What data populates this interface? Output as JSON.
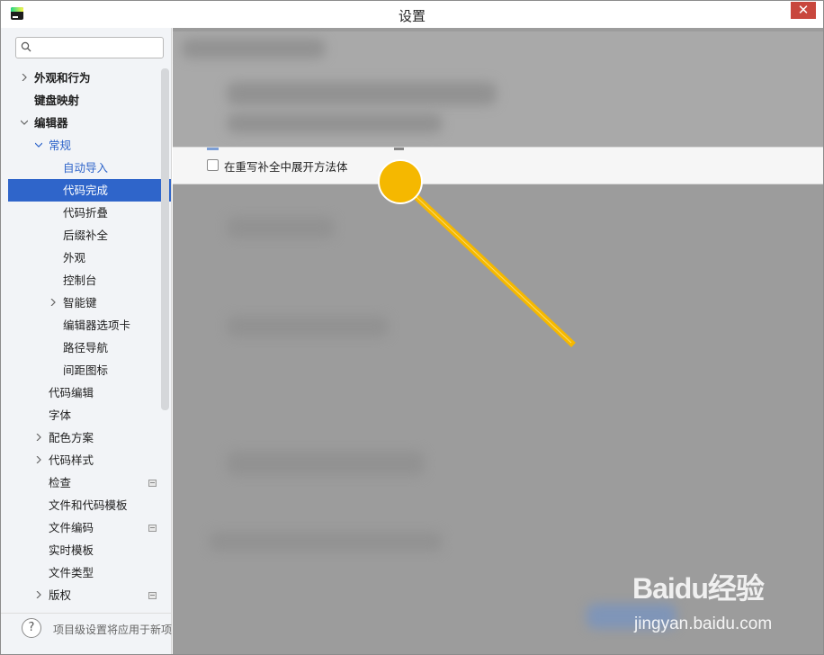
{
  "window": {
    "title": "设置",
    "close_symbol": "✕"
  },
  "search": {
    "placeholder": "",
    "icon": "search-icon"
  },
  "tree": {
    "items": [
      {
        "label": "外观和行为",
        "expandable": true,
        "expanded": false
      },
      {
        "label": "键盘映射",
        "expandable": false
      },
      {
        "label": "编辑器",
        "expandable": true,
        "expanded": true
      },
      {
        "label": "常规",
        "expandable": true,
        "expanded": true
      },
      {
        "label": "自动导入"
      },
      {
        "label": "代码完成",
        "selected": true
      },
      {
        "label": "代码折叠"
      },
      {
        "label": "后缀补全"
      },
      {
        "label": "外观"
      },
      {
        "label": "控制台"
      },
      {
        "label": "智能键",
        "expandable": true,
        "expanded": false
      },
      {
        "label": "编辑器选项卡"
      },
      {
        "label": "路径导航"
      },
      {
        "label": "间距图标"
      },
      {
        "label": "代码编辑"
      },
      {
        "label": "字体"
      },
      {
        "label": "配色方案",
        "expandable": true,
        "expanded": false
      },
      {
        "label": "代码样式",
        "expandable": true,
        "expanded": false
      },
      {
        "label": "检查",
        "badge": true
      },
      {
        "label": "文件和代码模板"
      },
      {
        "label": "文件编码",
        "badge": true
      },
      {
        "label": "实时模板"
      },
      {
        "label": "文件类型"
      },
      {
        "label": "版权",
        "expandable": true,
        "expanded": false,
        "badge": true
      }
    ]
  },
  "help": {
    "symbol": "?",
    "text": "项目级设置将应用于新项目"
  },
  "content": {
    "checkbox_label": "在重写补全中展开方法体",
    "checkbox_checked": false
  },
  "annotation": {
    "color": "#f5b800"
  },
  "watermark": {
    "brand": "Baidu经验",
    "url": "jingyan.baidu.com"
  }
}
